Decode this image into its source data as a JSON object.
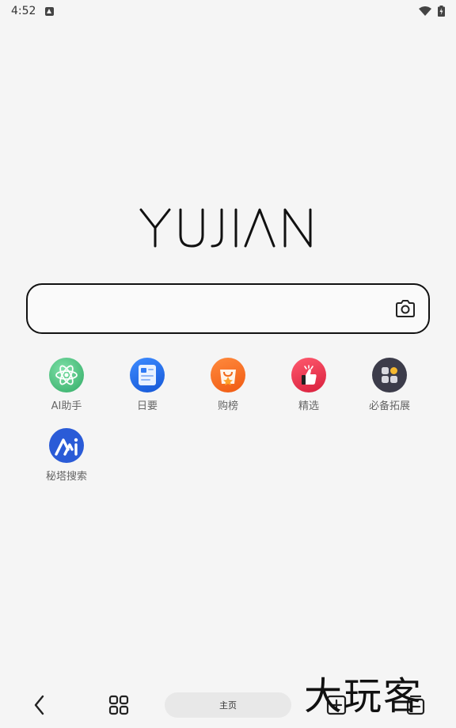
{
  "status_bar": {
    "time": "4:52",
    "notification_icon": "android-a-icon",
    "wifi_icon": "wifi-icon",
    "battery_icon": "battery-charging-icon"
  },
  "logo": {
    "text": "YUJIAN"
  },
  "search": {
    "value": "",
    "placeholder": "",
    "camera_icon": "camera-icon"
  },
  "shortcuts": [
    {
      "label": "AI助手",
      "icon": "atom-icon",
      "color": "#3cb371"
    },
    {
      "label": "日要",
      "icon": "news-icon",
      "color": "#1e6fe8"
    },
    {
      "label": "购榜",
      "icon": "shopping-bag-icon",
      "color": "#f26a1b"
    },
    {
      "label": "精选",
      "icon": "thumbs-up-icon",
      "color": "#e8304a"
    },
    {
      "label": "必备拓展",
      "icon": "extensions-grid-icon",
      "color": "#3c3c4a"
    },
    {
      "label": "秘塔搜索",
      "icon": "metaso-icon",
      "color": "#2a5bd7"
    }
  ],
  "bottom_nav": {
    "back_icon": "chevron-left-icon",
    "apps_icon": "grid-icon",
    "home_label": "主页",
    "new_tab_icon": "plus-square-icon",
    "tabs_icon": "tabs-icon"
  },
  "watermark": "大玩客"
}
